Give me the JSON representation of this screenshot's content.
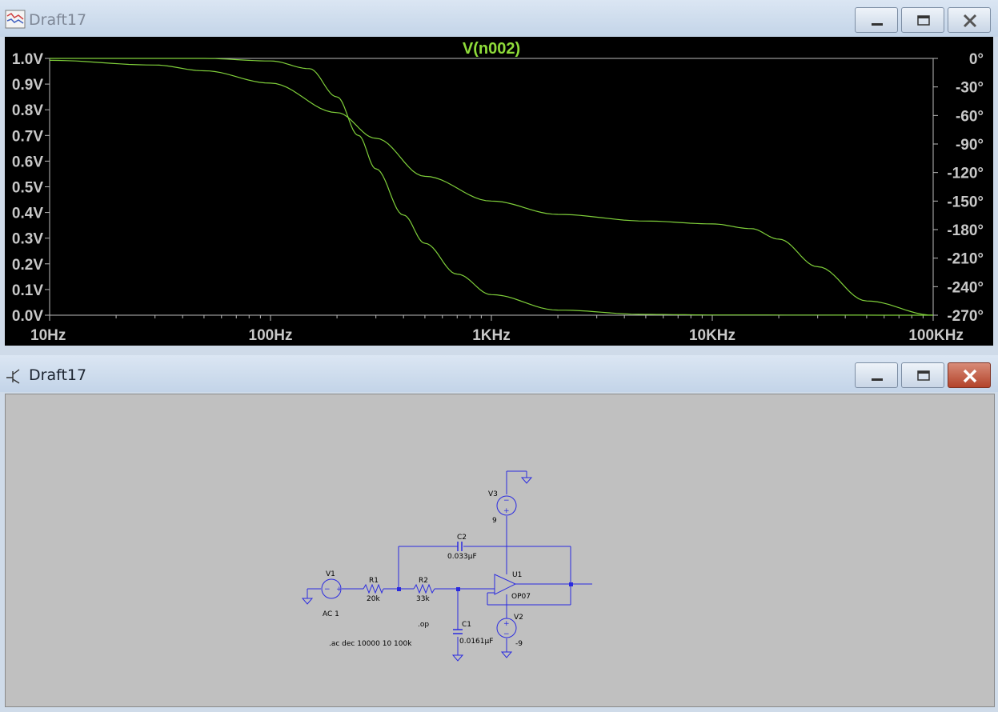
{
  "plot_window": {
    "title": "Draft17",
    "controls": {
      "minimize": "minimize",
      "maximize": "maximize",
      "close": "close"
    }
  },
  "schematic_window": {
    "title": "Draft17"
  },
  "colors": {
    "trace": "#7fcf3a",
    "plot_bg": "#000000",
    "axis_text": "#c8c8c8",
    "wire": "#2a2ae0",
    "schematic_bg": "#c0c0c0"
  },
  "chart_data": {
    "type": "line",
    "title": "V(n002)",
    "x_scale": "log",
    "x_range": [
      10,
      100000
    ],
    "x_ticks": [
      "10Hz",
      "100Hz",
      "1KHz",
      "10KHz",
      "100KHz"
    ],
    "x_tick_values": [
      10,
      100,
      1000,
      10000,
      100000
    ],
    "y_left_ticks": [
      "1.0V",
      "0.9V",
      "0.8V",
      "0.7V",
      "0.6V",
      "0.5V",
      "0.4V",
      "0.3V",
      "0.2V",
      "0.1V",
      "0.0V"
    ],
    "y_left_range": [
      0,
      1
    ],
    "y_right_ticks": [
      "0°",
      "-30°",
      "-60°",
      "-90°",
      "-120°",
      "-150°",
      "-180°",
      "-210°",
      "-240°",
      "-270°"
    ],
    "y_right_range": [
      -270,
      0
    ],
    "series": [
      {
        "axis": "left",
        "x": [
          10,
          50,
          100,
          150,
          200,
          250,
          300,
          400,
          500,
          700,
          1000,
          2000,
          5000,
          10000,
          100000
        ],
        "values": [
          1.0,
          1.0,
          0.99,
          0.96,
          0.85,
          0.7,
          0.57,
          0.39,
          0.28,
          0.16,
          0.08,
          0.02,
          0.003,
          0.001,
          0.0
        ]
      },
      {
        "axis": "right",
        "x": [
          10,
          30,
          50,
          100,
          200,
          300,
          500,
          1000,
          2000,
          5000,
          10000,
          15000,
          20000,
          30000,
          50000,
          100000
        ],
        "values": [
          -2,
          -7,
          -13,
          -26,
          -57,
          -84,
          -124,
          -150,
          -164,
          -171,
          -174,
          -179,
          -190,
          -219,
          -255,
          -270
        ]
      }
    ],
    "grid": false
  },
  "schematic": {
    "V1": {
      "name": "V1",
      "value": "AC 1"
    },
    "R1": {
      "name": "R1",
      "value": "20k"
    },
    "R2": {
      "name": "R2",
      "value": "33k"
    },
    "C1": {
      "name": "C1",
      "value": "0.0161µF"
    },
    "C2": {
      "name": "C2",
      "value": "0.033µF"
    },
    "U1": {
      "name": "U1",
      "value": "OP07"
    },
    "V2": {
      "name": "V2",
      "value": "-9"
    },
    "V3": {
      "name": "V3",
      "value": "9"
    },
    "directive_op": ".op",
    "directive_ac": ".ac dec 10000 10 100k"
  }
}
